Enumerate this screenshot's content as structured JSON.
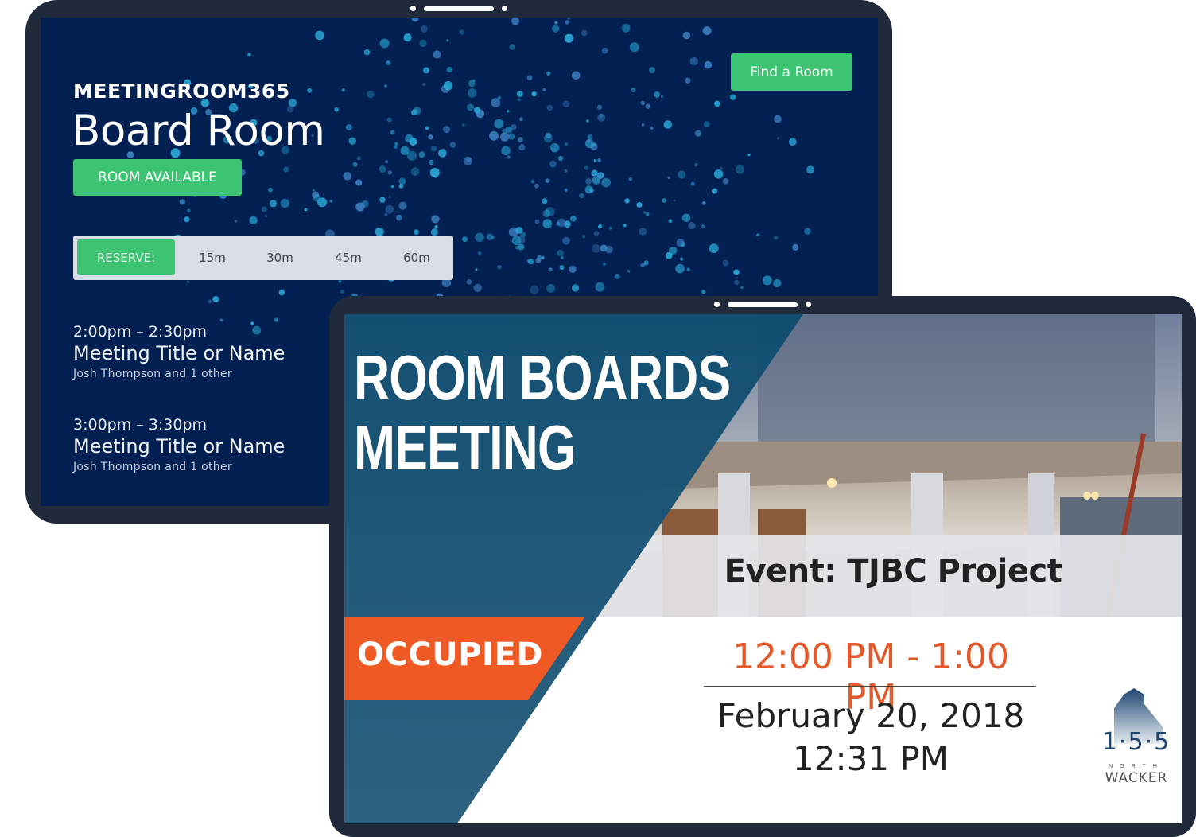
{
  "tablet_left": {
    "brand": "MEETINGROOM365",
    "room_name": "Board Room",
    "status": "ROOM AVAILABLE",
    "find_room_button": "Find a Room",
    "reserve": {
      "label": "RESERVE:",
      "options": [
        "15m",
        "30m",
        "45m",
        "60m"
      ]
    },
    "meetings": [
      {
        "time": "2:00pm – 2:30pm",
        "title": "Meeting Title or Name",
        "people": "Josh Thompson and 1 other"
      },
      {
        "time": "3:00pm – 3:30pm",
        "title": "Meeting Title or Name",
        "people": "Josh Thompson and 1 other"
      }
    ],
    "colors": {
      "background": "#022152",
      "accent": "#3cc472",
      "frame": "#212a3b"
    }
  },
  "tablet_right": {
    "headline_line1": "ROOM BOARDS",
    "headline_line2": "MEETING",
    "status": "OCCUPIED",
    "event": "Event: TJBC Project",
    "event_time": "12:00 PM - 1:00 PM",
    "date": "February 20, 2018",
    "clock": "12:31 PM",
    "logo": {
      "number": "1·5·5",
      "north": "NORTH",
      "street": "WACKER"
    },
    "colors": {
      "panel": "#1d5a7c",
      "status": "#ef5a24",
      "time": "#e4582a"
    }
  }
}
